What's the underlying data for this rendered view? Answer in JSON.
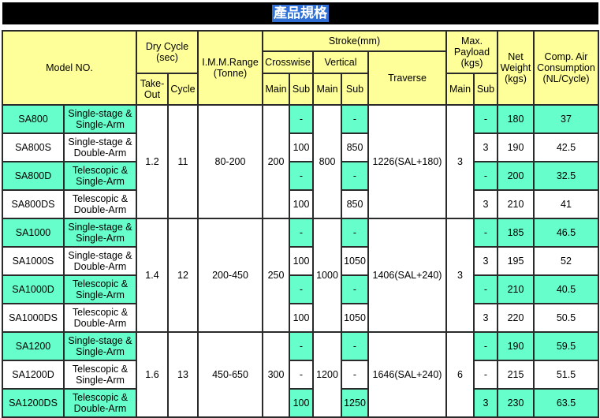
{
  "title": "產品規格",
  "colors": {
    "header_bg": "#ffff99",
    "green_row": "#66ffcc",
    "white_row": "#ffffff",
    "title_bar": "#000000",
    "title_highlight": "#2f6fd6"
  },
  "headers": {
    "model": "Model NO.",
    "dry_cycle": "Dry Cycle (sec)",
    "take_out": "Take-Out",
    "cycle": "Cycle",
    "imm_range": "I.M.M.Range (Tonne)",
    "stroke": "Stroke(mm)",
    "crosswise": "Crosswise",
    "vertical": "Vertical",
    "traverse": "Traverse",
    "main": "Main",
    "sub": "Sub",
    "max_payload": "Max. Payload (kgs)",
    "net_weight": "Net Weight (kgs)",
    "air": "Comp. Air Consumption (NL/Cycle)"
  },
  "groups": [
    {
      "take_out": "1.2",
      "cycle": "11",
      "imm_range": "80-200",
      "crosswise_main": "200",
      "vertical_main": "800",
      "traverse": "1226(SAL+180)",
      "payload_main": "3",
      "rows": [
        {
          "model": "SA800",
          "desc": "Single-stage & Single-Arm",
          "cross_sub": "-",
          "vert_sub": "-",
          "payload_sub": "-",
          "weight": "180",
          "air": "37"
        },
        {
          "model": "SA800S",
          "desc": "Single-stage & Double-Arm",
          "cross_sub": "100",
          "vert_sub": "850",
          "payload_sub": "3",
          "weight": "190",
          "air": "42.5"
        },
        {
          "model": "SA800D",
          "desc": "Telescopic & Single-Arm",
          "cross_sub": "-",
          "vert_sub": "-",
          "payload_sub": "-",
          "weight": "200",
          "air": "32.5"
        },
        {
          "model": "SA800DS",
          "desc": "Telescopic & Double-Arm",
          "cross_sub": "100",
          "vert_sub": "850",
          "payload_sub": "3",
          "weight": "210",
          "air": "41"
        }
      ]
    },
    {
      "take_out": "1.4",
      "cycle": "12",
      "imm_range": "200-450",
      "crosswise_main": "250",
      "vertical_main": "1000",
      "traverse": "1406(SAL+240)",
      "payload_main": "3",
      "rows": [
        {
          "model": "SA1000",
          "desc": "Single-stage & Single-Arm",
          "cross_sub": "-",
          "vert_sub": "-",
          "payload_sub": "-",
          "weight": "185",
          "air": "46.5"
        },
        {
          "model": "SA1000S",
          "desc": "Single-stage & Double-Arm",
          "cross_sub": "100",
          "vert_sub": "1050",
          "payload_sub": "3",
          "weight": "195",
          "air": "52"
        },
        {
          "model": "SA1000D",
          "desc": "Telescopic & Single-Arm",
          "cross_sub": "-",
          "vert_sub": "-",
          "payload_sub": "-",
          "weight": "210",
          "air": "40.5"
        },
        {
          "model": "SA1000DS",
          "desc": "Telescopic & Double-Arm",
          "cross_sub": "100",
          "vert_sub": "1050",
          "payload_sub": "3",
          "weight": "220",
          "air": "50.5"
        }
      ]
    },
    {
      "take_out": "1.6",
      "cycle": "13",
      "imm_range": "450-650",
      "crosswise_main": "300",
      "vertical_main": "1200",
      "traverse": "1646(SAL+240)",
      "payload_main": "6",
      "rows": [
        {
          "model": "SA1200",
          "desc": "Single-stage & Single-Arm",
          "cross_sub": "-",
          "vert_sub": "-",
          "payload_sub": "-",
          "weight": "190",
          "air": "59.5"
        },
        {
          "model": "SA1200D",
          "desc": "Telescopic & Single-Arm",
          "cross_sub": "-",
          "vert_sub": "-",
          "payload_sub": "-",
          "weight": "215",
          "air": "51.5",
          "plain": true
        },
        {
          "model": "SA1200DS",
          "desc": "Telescopic & Double-Arm",
          "cross_sub": "100",
          "vert_sub": "1250",
          "payload_sub": "3",
          "weight": "230",
          "air": "63.5"
        }
      ]
    }
  ]
}
